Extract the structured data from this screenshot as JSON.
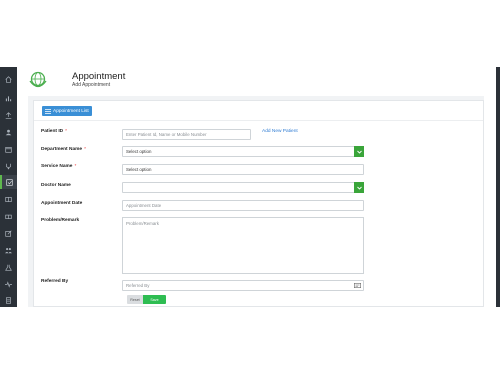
{
  "colors": {
    "sidebar": "#2b3138",
    "accent_green": "#3aa53a",
    "primary_blue": "#3a8fd6",
    "link_blue": "#2f7cd3"
  },
  "sidebar": {
    "items": [
      {
        "icon": "home-icon"
      },
      {
        "icon": "bar-chart-icon"
      },
      {
        "icon": "upload-icon"
      },
      {
        "icon": "user-icon"
      },
      {
        "icon": "calendar-icon"
      },
      {
        "icon": "stethoscope-icon"
      },
      {
        "icon": "appointment-icon"
      },
      {
        "icon": "book-icon"
      },
      {
        "icon": "bed-icon"
      },
      {
        "icon": "edit-icon"
      },
      {
        "icon": "users-icon"
      },
      {
        "icon": "flask-icon"
      },
      {
        "icon": "heartbeat-icon"
      },
      {
        "icon": "document-icon"
      }
    ]
  },
  "header": {
    "title": "Appointment",
    "subtitle": "Add Appointment"
  },
  "toolbar": {
    "appointment_list_label": "Appointment List",
    "appointment_list_icon": "list-icon"
  },
  "form": {
    "patient_id": {
      "label": "Patient ID",
      "required": "*",
      "placeholder": "Enter Patient Id, Name or Mobile Number",
      "link": "Add New Patient"
    },
    "department": {
      "label": "Department Name",
      "required": "*",
      "value": "Select option"
    },
    "service": {
      "label": "Service Name",
      "required": "*",
      "value": "Select option"
    },
    "doctor": {
      "label": "Doctor Name",
      "value": ""
    },
    "appointment_date": {
      "label": "Appointment Date",
      "placeholder": "Appointment Date"
    },
    "problem": {
      "label": "Problem/Remark",
      "placeholder": "Problem/Remark"
    },
    "referred_by": {
      "label": "Referred By",
      "placeholder": "Referred By"
    },
    "toggle": {
      "off_label": "Reset",
      "on_label": "Save"
    }
  }
}
